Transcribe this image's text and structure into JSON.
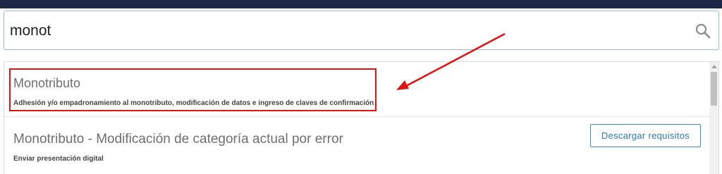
{
  "search": {
    "value": "monot",
    "icon": "search-icon"
  },
  "results": [
    {
      "title": "Monotributo",
      "description": "Adhesión y/o empadronamiento al monotributo, modificación de datos e ingreso de claves de confirmación"
    },
    {
      "title": "Monotributo - Modificación de categoría actual por error",
      "description": "Enviar presentación digital",
      "button_label": "Descargar requisitos"
    }
  ],
  "colors": {
    "top_strip": "#1d2847",
    "annotation": "#e01313",
    "button_accent": "#2b7aa8"
  }
}
